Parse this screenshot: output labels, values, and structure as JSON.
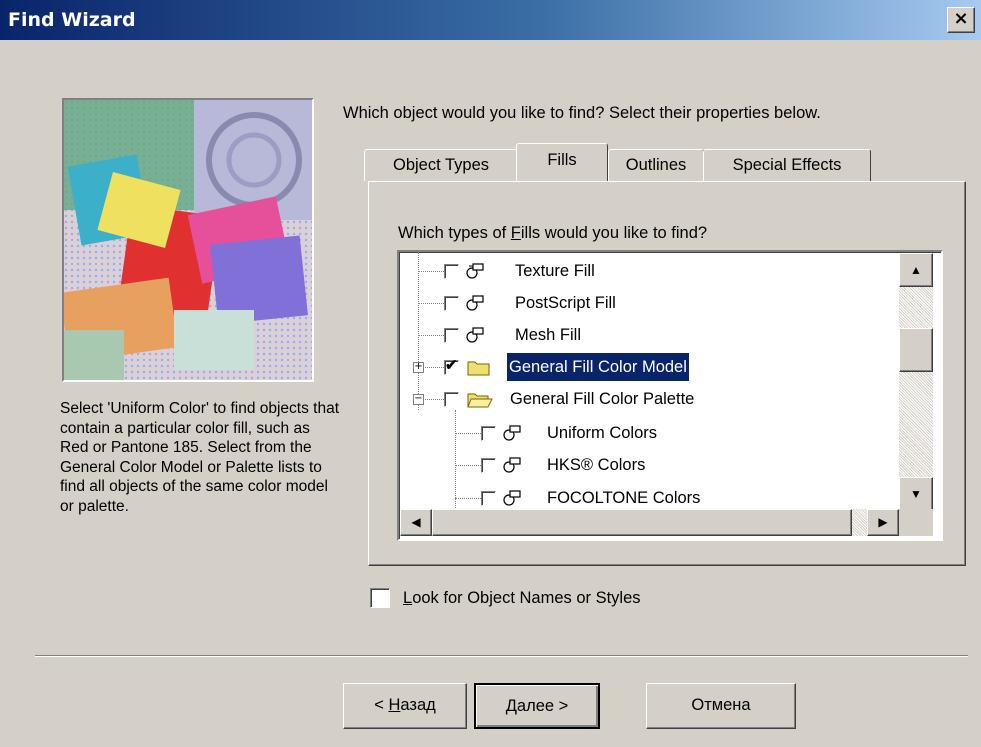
{
  "window": {
    "title": "Find Wizard",
    "close_glyph": "×"
  },
  "sidebar": {
    "hint": "Select 'Uniform Color' to find objects that contain a particular color fill, such as Red or Pantone 185. Select from the General Color Model or Palette lists to find all objects of the same color model or palette."
  },
  "main": {
    "question": "Which object would you like to find?  Select their properties below.",
    "tabs": [
      {
        "label": "Object Types",
        "active": false
      },
      {
        "label": "Fills",
        "active": true
      },
      {
        "label": "Outlines",
        "active": false
      },
      {
        "label": "Special Effects",
        "active": false
      }
    ],
    "tree_label_pre": "Which types of ",
    "tree_label_mnemonic": "F",
    "tree_label_post": "ills would you like to find?",
    "tree": [
      {
        "label": "Texture Fill",
        "checked": false,
        "icon": "fill-icon"
      },
      {
        "label": "PostScript Fill",
        "checked": false,
        "icon": "fill-icon"
      },
      {
        "label": "Mesh Fill",
        "checked": false,
        "icon": "fill-icon"
      },
      {
        "label": "General Fill Color Model",
        "checked": true,
        "icon": "folder-icon",
        "expander": "+",
        "selected": true
      },
      {
        "label": "General Fill Color Palette",
        "checked": false,
        "icon": "folder-open-icon",
        "expander": "−"
      },
      {
        "label": "Uniform Colors",
        "checked": false,
        "icon": "fill-icon"
      },
      {
        "label": "HKS® Colors",
        "checked": false,
        "icon": "fill-icon"
      },
      {
        "label": "FOCOLTONE Colors",
        "checked": false,
        "icon": "fill-icon"
      }
    ],
    "look_mnemonic": "L",
    "look_rest": "ook for Object Names or Styles",
    "look_checked": false
  },
  "footer": {
    "back_prefix": "< ",
    "back_mnemonic": "Н",
    "back_rest": "азад",
    "next_label": "Далее >",
    "cancel_label": "Отмена"
  }
}
